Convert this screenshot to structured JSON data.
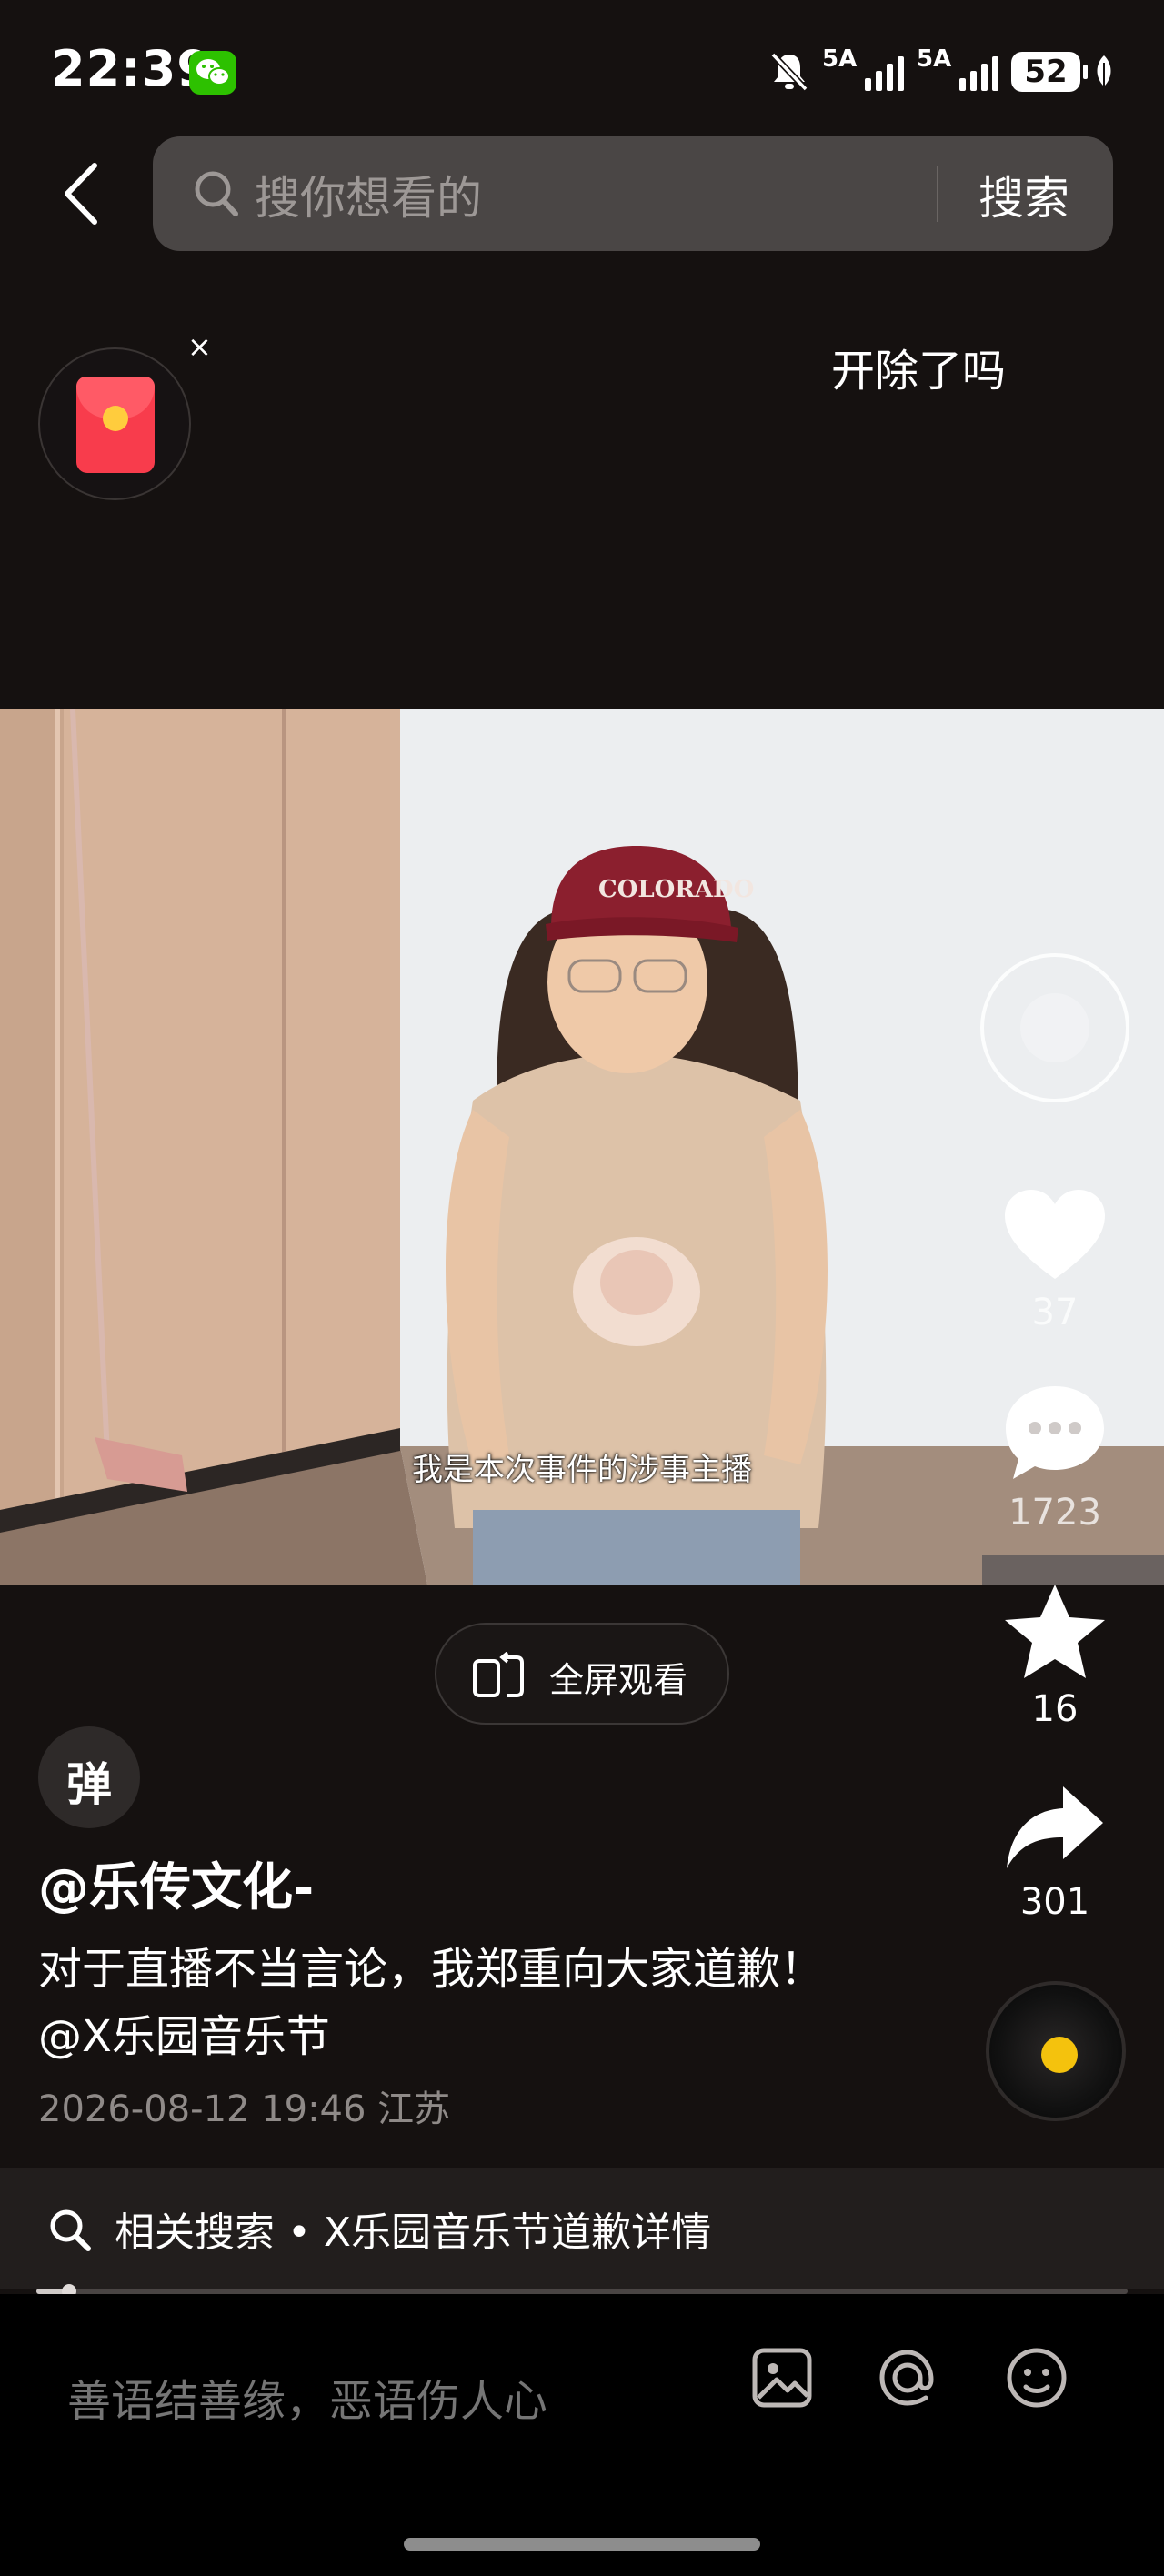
{
  "status": {
    "time": "22:39",
    "sig1": "5A",
    "sig2": "5A",
    "battery": "52"
  },
  "header": {
    "search_placeholder": "搜你想看的",
    "search_button": "搜索"
  },
  "top": {
    "topic": "开除了吗",
    "close": "×"
  },
  "video": {
    "subtitle": "我是本次事件的涉事主播"
  },
  "actions": {
    "likes": "37",
    "comments": "1723",
    "favorites": "16",
    "shares": "301"
  },
  "fullscreen_label": "全屏观看",
  "danmu_label": "弹",
  "post": {
    "author": "@乐传文化-",
    "description": "对于直播不当言论，我郑重向大家道歉！@X乐园音乐节",
    "meta": "2026-08-12 19:46 江苏"
  },
  "related": {
    "text": "相关搜索 • X乐园音乐节道歉详情"
  },
  "progress": 0.03,
  "comment": {
    "placeholder": "善语结善缘，恶语伤人心"
  }
}
